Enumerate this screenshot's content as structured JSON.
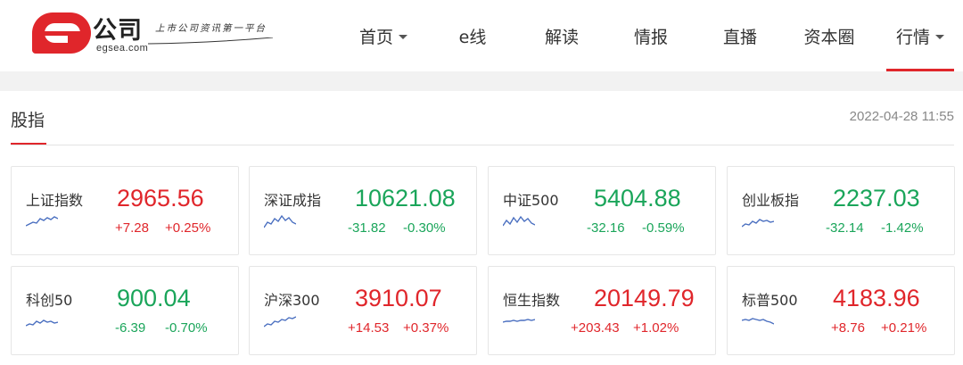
{
  "logo": {
    "cn": "公司",
    "en": "egsea.com",
    "slogan": "上市公司资讯第一平台"
  },
  "nav": [
    {
      "label": "首页",
      "dropdown": true,
      "active": false
    },
    {
      "label": "e线",
      "dropdown": false,
      "active": false
    },
    {
      "label": "解读",
      "dropdown": false,
      "active": false
    },
    {
      "label": "情报",
      "dropdown": false,
      "active": false
    },
    {
      "label": "直播",
      "dropdown": false,
      "active": false
    },
    {
      "label": "资本圈",
      "dropdown": false,
      "active": false
    },
    {
      "label": "行情",
      "dropdown": true,
      "active": true
    }
  ],
  "section": {
    "title": "股指",
    "timestamp": "2022-04-28 11:55"
  },
  "colors": {
    "up": "#e0262b",
    "down": "#1aa55a",
    "spark": "#4a6fc0"
  },
  "indices": [
    {
      "name": "上证指数",
      "price": "2965.56",
      "change": "+7.28",
      "pct": "+0.25%",
      "dir": "up"
    },
    {
      "name": "深证成指",
      "price": "10621.08",
      "change": "-31.82",
      "pct": "-0.30%",
      "dir": "down"
    },
    {
      "name": "中证500",
      "price": "5404.88",
      "change": "-32.16",
      "pct": "-0.59%",
      "dir": "down"
    },
    {
      "name": "创业板指",
      "price": "2237.03",
      "change": "-32.14",
      "pct": "-1.42%",
      "dir": "down"
    },
    {
      "name": "科创50",
      "price": "900.04",
      "change": "-6.39",
      "pct": "-0.70%",
      "dir": "down"
    },
    {
      "name": "沪深300",
      "price": "3910.07",
      "change": "+14.53",
      "pct": "+0.37%",
      "dir": "up"
    },
    {
      "name": "恒生指数",
      "price": "20149.79",
      "change": "+203.43",
      "pct": "+1.02%",
      "dir": "up"
    },
    {
      "name": "标普500",
      "price": "4183.96",
      "change": "+8.76",
      "pct": "+0.21%",
      "dir": "up"
    }
  ]
}
